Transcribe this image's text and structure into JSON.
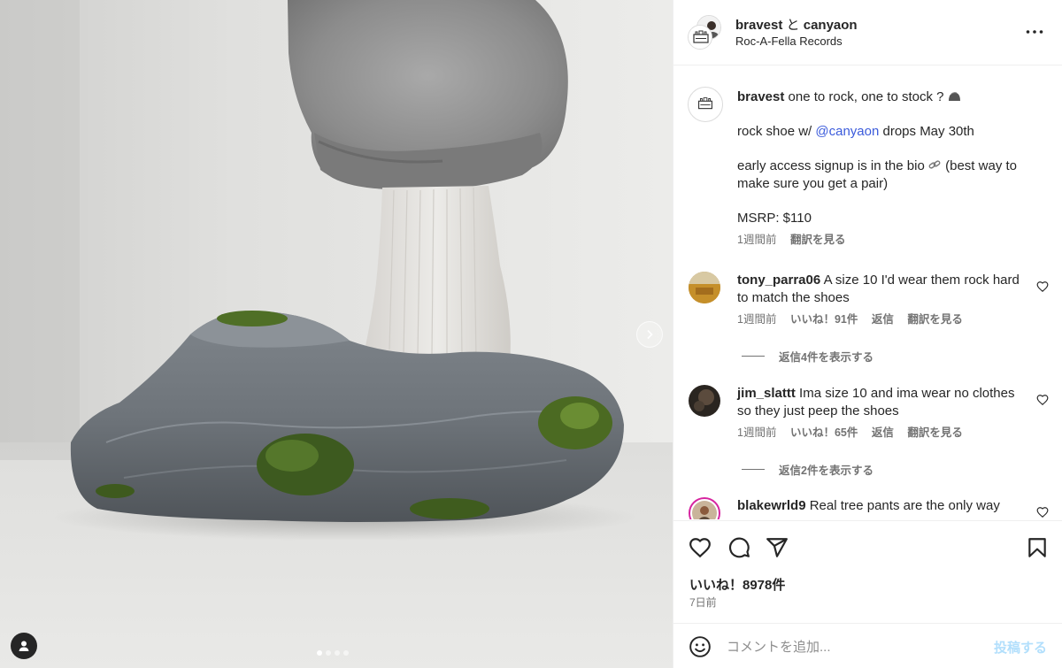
{
  "post_header": {
    "author": "bravest",
    "connector": "と",
    "coauthor": "canyaon",
    "subtitle": "Roc-A-Fella Records",
    "more_icon": "more-horizontal-icon"
  },
  "caption": {
    "username": "bravest",
    "line1": "one to rock, one to stock ?",
    "line1_emoji": "rock-emoji",
    "line2_prefix": "rock shoe w/",
    "line2_mention": "@canyaon",
    "line2_suffix": "drops May 30th",
    "line3_prefix": "early access signup is in the bio",
    "line3_emoji": "link-emoji",
    "line3_suffix": "(best way to make sure you get a pair)",
    "line4": "MSRP: $110",
    "time": "1週間前",
    "translate": "翻訳を見る"
  },
  "comments": [
    {
      "username": "tony_parra06",
      "text": "A size 10 I'd wear them rock hard to match the shoes",
      "time": "1週間前",
      "likes": "いいね！91件",
      "reply": "返信",
      "translate": "翻訳を見る",
      "view_replies": "返信4件を表示する"
    },
    {
      "username": "jim_slattt",
      "text": "Ima size 10 and ima wear no clothes so they just peep the shoes",
      "time": "1週間前",
      "likes": "いいね！65件",
      "reply": "返信",
      "translate": "翻訳を見る",
      "view_replies": "返信2件を表示する"
    },
    {
      "username": "blakewrld9",
      "text": "Real tree pants are the only way"
    }
  ],
  "actions": {
    "icons": [
      "heart-icon",
      "comment-icon",
      "share-icon",
      "bookmark-icon"
    ],
    "likes_text": "いいね！8978件",
    "posted_time": "7日前"
  },
  "add_comment": {
    "placeholder": "コメントを追加...",
    "post_label": "投稿する",
    "emoji_icon": "emoji-icon"
  },
  "carousel": {
    "slide_count": 4,
    "active_index": 0
  },
  "colors": {
    "text": "#262626",
    "secondary": "#737373",
    "mention": "#3b5bdb",
    "post_button_disabled": "#b2dffc",
    "divider": "#efefef"
  }
}
